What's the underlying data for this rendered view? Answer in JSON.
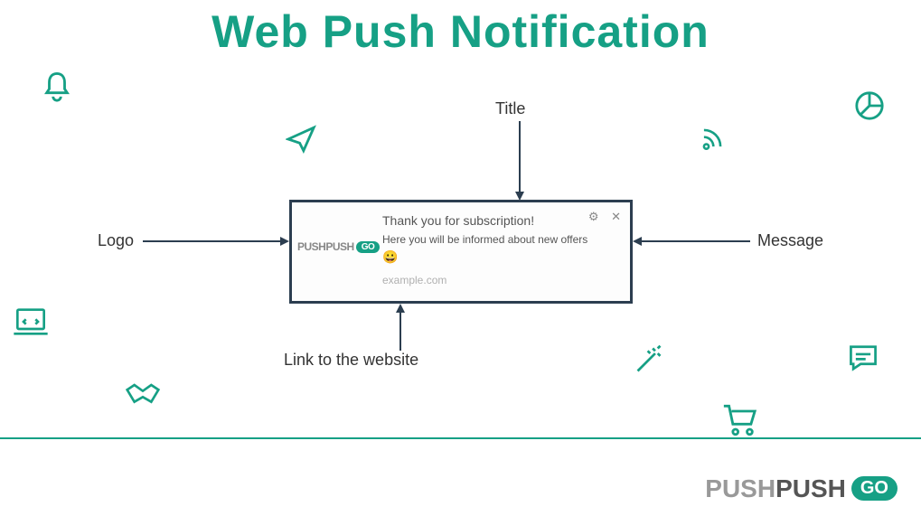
{
  "heading": "Web Push Notification",
  "labels": {
    "title": "Title",
    "logo": "Logo",
    "message": "Message",
    "link": "Link to the website"
  },
  "notification": {
    "logo_text": "PUSHPUSH",
    "logo_badge": "GO",
    "title": "Thank you for subscription!",
    "message": "Here you will be informed about new offers",
    "emoji": "😀",
    "link": "example.com",
    "gear_icon": "⚙",
    "close_icon": "✕"
  },
  "brand": {
    "part1": "PUSH",
    "part2": "PUSH",
    "badge": "GO"
  }
}
